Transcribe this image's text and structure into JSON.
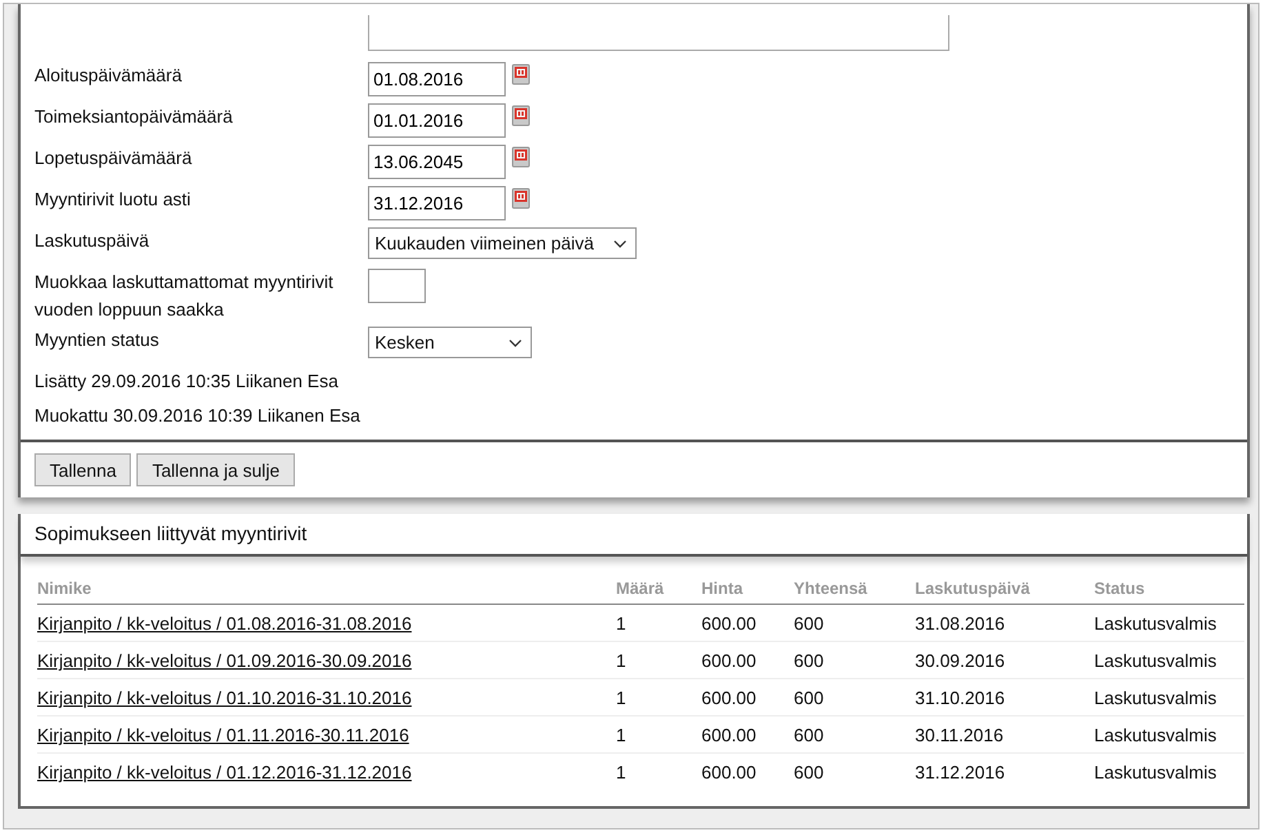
{
  "fields": [
    {
      "kind": "date",
      "label": "Aloituspäivämäärä",
      "value": "01.08.2016"
    },
    {
      "kind": "date",
      "label": "Toimeksiantopäivämäärä",
      "value": "01.01.2016"
    },
    {
      "kind": "date",
      "label": "Lopetuspäivämäärä",
      "value": "13.06.2045"
    },
    {
      "kind": "date",
      "label": "Myyntirivit luotu asti",
      "value": "31.12.2016"
    },
    {
      "kind": "select",
      "label": "Laskutuspäivä",
      "value": "Kuukauden viimeinen päivä"
    },
    {
      "kind": "text",
      "label": "Muokkaa laskuttamattomat myyntirivit vuoden loppuun saakka"
    },
    {
      "kind": "select-small",
      "label": "Myyntien status",
      "value": "Kesken"
    }
  ],
  "meta": [
    "Lisätty 29.09.2016 10:35 Liikanen Esa",
    "Muokattu 30.09.2016 10:39 Liikanen Esa"
  ],
  "buttons": [
    "Tallenna",
    "Tallenna ja sulje"
  ],
  "section_title": "Sopimukseen liittyvät myyntirivit",
  "table": {
    "columns": [
      "Nimike",
      "Määrä",
      "Hinta",
      "Yhteensä",
      "Laskutuspäivä",
      "Status"
    ],
    "rows": [
      [
        "Kirjanpito / kk-veloitus / 01.08.2016-31.08.2016",
        "1",
        "600.00",
        "600",
        "31.08.2016",
        "Laskutusvalmis"
      ],
      [
        "Kirjanpito / kk-veloitus / 01.09.2016-30.09.2016",
        "1",
        "600.00",
        "600",
        "30.09.2016",
        "Laskutusvalmis"
      ],
      [
        "Kirjanpito / kk-veloitus / 01.10.2016-31.10.2016",
        "1",
        "600.00",
        "600",
        "31.10.2016",
        "Laskutusvalmis"
      ],
      [
        "Kirjanpito / kk-veloitus / 01.11.2016-30.11.2016",
        "1",
        "600.00",
        "600",
        "30.11.2016",
        "Laskutusvalmis"
      ],
      [
        "Kirjanpito / kk-veloitus / 01.12.2016-31.12.2016",
        "1",
        "600.00",
        "600",
        "31.12.2016",
        "Laskutusvalmis"
      ]
    ]
  }
}
